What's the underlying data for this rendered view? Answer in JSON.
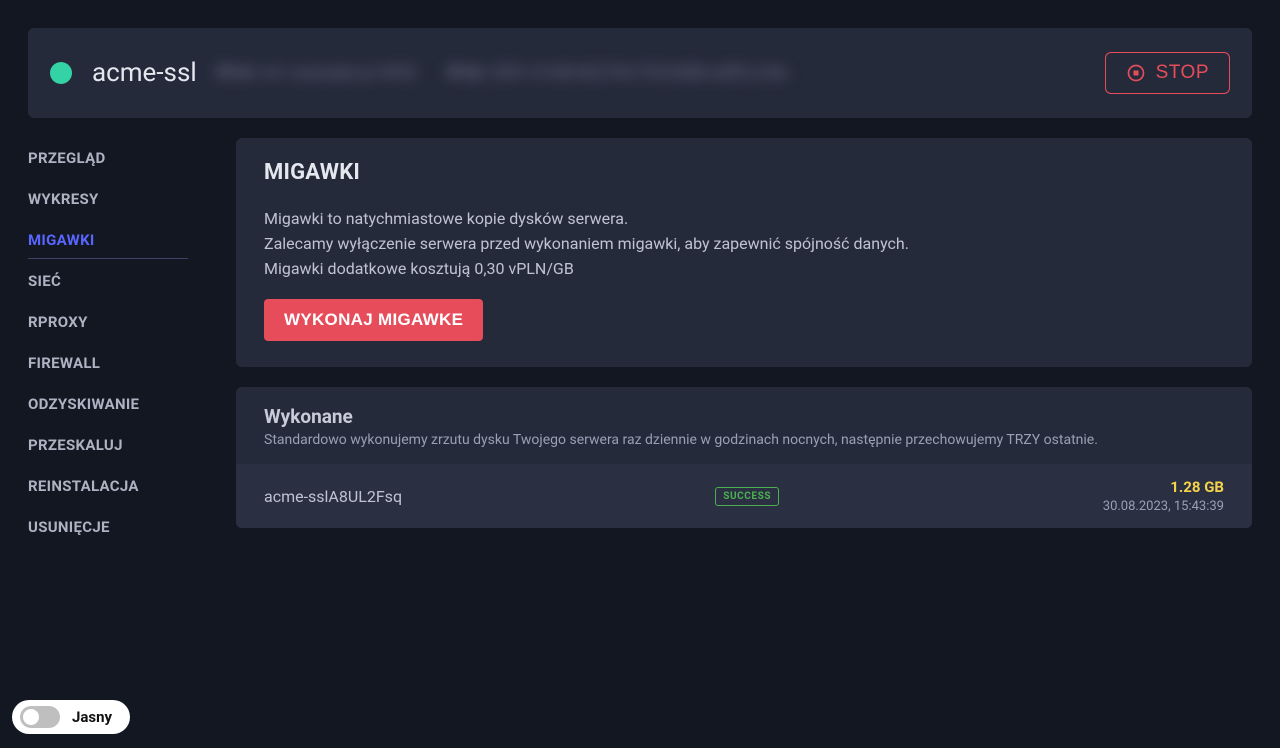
{
  "header": {
    "server_name": "acme-ssl",
    "blur_ipv4_label": "IPv4:",
    "blur_ipv4_value": "ns1.example.pl 4952",
    "blur_ipv6_label": "IPv6:",
    "blur_ipv6_value": "2001:41d8:602:f54:705:8d86:a8f0:c24e",
    "stop_label": "STOP"
  },
  "sidebar": {
    "items": [
      {
        "label": "PRZEGLĄD"
      },
      {
        "label": "WYKRESY"
      },
      {
        "label": "MIGAWKI"
      },
      {
        "label": "SIEĆ"
      },
      {
        "label": "RPROXY"
      },
      {
        "label": "FIREWALL"
      },
      {
        "label": "ODZYSKIWANIE"
      },
      {
        "label": "PRZESKALUJ"
      },
      {
        "label": "REINSTALACJA"
      },
      {
        "label": "USUNIĘCJE"
      }
    ],
    "active_index": 2
  },
  "snapshots_panel": {
    "title": "MIGAWKI",
    "desc1": "Migawki to natychmiastowe kopie dysków serwera.",
    "desc2": "Zalecamy wyłączenie serwera przed wykonaniem migawki, aby zapewnić spójność danych.",
    "desc3": "Migawki dodatkowe kosztują 0,30 vPLN/GB",
    "action_label": "WYKONAJ MIGAWKE"
  },
  "completed": {
    "title": "Wykonane",
    "subtitle": "Standardowo wykonujemy zrzutu dysku Twojego serwera raz dziennie w godzinach nocnych, następnie przechowujemy TRZY ostatnie.",
    "rows": [
      {
        "name": "acme-sslA8UL2Fsq",
        "status": "SUCCESS",
        "size": "1.28 GB",
        "date": "30.08.2023, 15:43:39"
      }
    ]
  },
  "theme_toggle": {
    "label": "Jasny"
  }
}
